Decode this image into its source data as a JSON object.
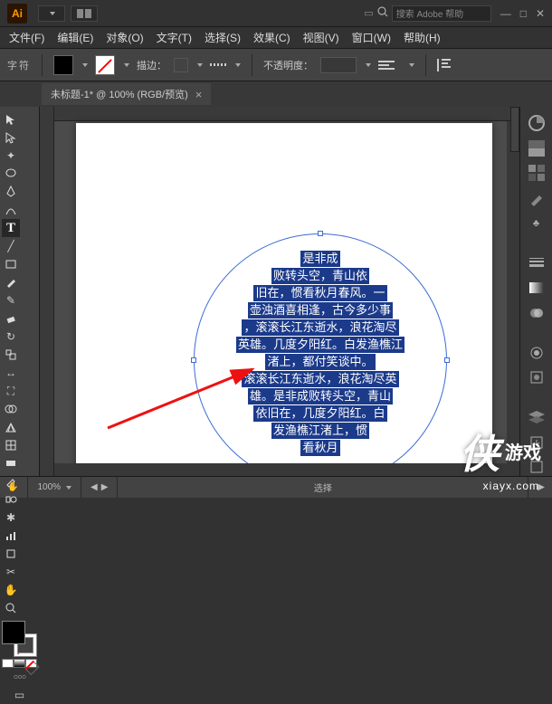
{
  "titlebar": {
    "logo": "Ai",
    "search_placeholder": "搜索 Adobe 帮助"
  },
  "menubar": [
    "文件(F)",
    "编辑(E)",
    "对象(O)",
    "文字(T)",
    "选择(S)",
    "效果(C)",
    "视图(V)",
    "窗口(W)",
    "帮助(H)"
  ],
  "optbar": {
    "char_label": "字符",
    "stroke_label": "描边：",
    "opacity_label": "不透明度："
  },
  "doctab": {
    "title": "未标题-1* @ 100% (RGB/预览)",
    "close": "×"
  },
  "canvas_text_lines": [
    "是非成",
    "败转头空，青山依",
    "旧在，惯看秋月春风。一",
    "壶浊酒喜相逢，古今多少事",
    "，滚滚长江东逝水，浪花淘尽",
    "英雄。几度夕阳红。白发渔樵江",
    "渚上，都付笑谈中。",
    "滚滚长江东逝水，浪花淘尽英",
    "雄。是非成败转头空，青山",
    "依旧在，几度夕阳红。白",
    "发渔樵江渚上，惯",
    "看秋月"
  ],
  "statusbar": {
    "zoom": "100%",
    "mode": "选择"
  },
  "watermark": {
    "character": "侠",
    "brand": "游戏",
    "url": "xiayx.com"
  }
}
